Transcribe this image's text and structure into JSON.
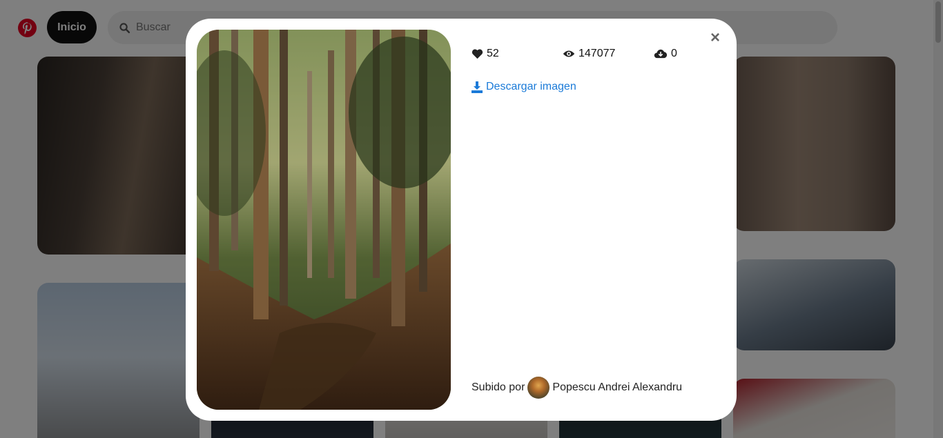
{
  "header": {
    "logo_icon": "pinterest-logo-icon",
    "home_label": "Inicio",
    "search": {
      "icon": "search-icon",
      "placeholder": "Buscar"
    }
  },
  "modal": {
    "close_label": "×",
    "stats": {
      "likes": {
        "icon": "heart-icon",
        "value": "52"
      },
      "views": {
        "icon": "eye-icon",
        "value": "147077"
      },
      "downloads": {
        "icon": "cloud-download-icon",
        "value": "0"
      }
    },
    "download_link": {
      "icon": "download-icon",
      "label": "Descargar imagen"
    },
    "uploader": {
      "prefix": "Subido por",
      "name": "Popescu Andrei Alexandru"
    }
  },
  "colors": {
    "accent_link": "#1a7ad8",
    "brand_red": "#e60023",
    "home_pill": "#111111"
  }
}
